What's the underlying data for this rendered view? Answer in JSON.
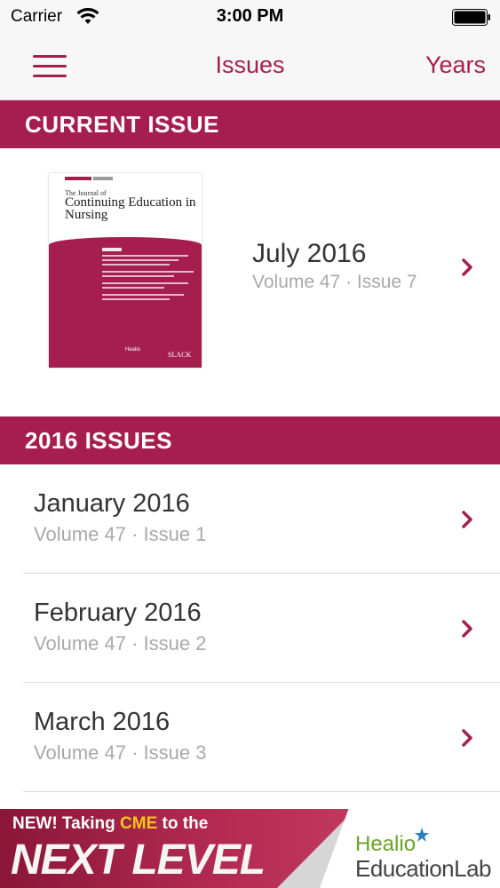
{
  "status_bar": {
    "carrier": "Carrier",
    "time": "3:00 PM"
  },
  "nav": {
    "title": "Issues",
    "years_label": "Years"
  },
  "current_section": {
    "header": "CURRENT ISSUE"
  },
  "current_issue": {
    "title": "July 2016",
    "subtitle": "Volume 47 · Issue 7",
    "cover": {
      "journal_small": "The Journal of",
      "journal_title": "Continuing Education in Nursing",
      "brand_healio": "Healio",
      "brand_slack": "SLACK"
    }
  },
  "year_section": {
    "header": "2016 ISSUES"
  },
  "issues": [
    {
      "title": "January 2016",
      "subtitle": "Volume 47 · Issue 1"
    },
    {
      "title": "February 2016",
      "subtitle": "Volume 47 · Issue 2"
    },
    {
      "title": "March 2016",
      "subtitle": "Volume 47 · Issue 3"
    }
  ],
  "ad": {
    "new_prefix": "NEW! Taking ",
    "cme": "CME",
    "new_suffix": " to the",
    "headline": "NEXT LEVEL",
    "brand_top": "Healio",
    "brand_bottom": "EducationLab"
  },
  "colors": {
    "accent": "#a61e4d",
    "subtext": "#a9a9a9",
    "ad_highlight": "#f5c518"
  },
  "icons": {
    "menu": "hamburger-menu-icon",
    "chevron": "chevron-right-icon",
    "wifi": "wifi-icon",
    "battery": "battery-icon"
  }
}
